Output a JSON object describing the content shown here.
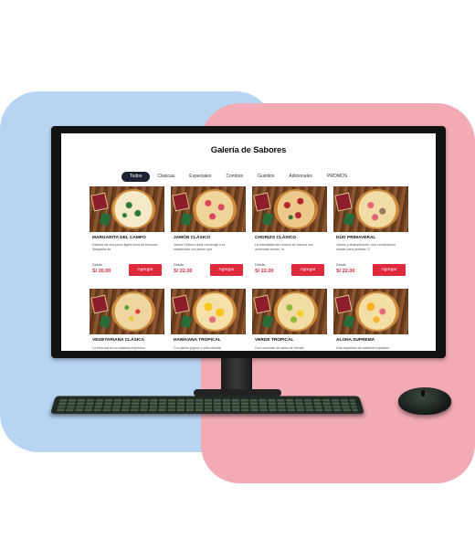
{
  "page": {
    "title": "Galería de Sabores"
  },
  "tabs": [
    {
      "label": "Todos",
      "active": true
    },
    {
      "label": "Clasicas",
      "active": false
    },
    {
      "label": "Especiales",
      "active": false
    },
    {
      "label": "Combos",
      "active": false
    },
    {
      "label": "Gustitos",
      "active": false
    },
    {
      "label": "Adicionales",
      "active": false
    },
    {
      "label": "PROMOS",
      "active": false
    }
  ],
  "products": [
    {
      "name": "MARGARITA DEL CAMPO",
      "desc": "Disfruta de una pizza ligera llena de frescura. Margarita de",
      "from_label": "Desde",
      "price": "S/ 20.00",
      "button": "Agregar",
      "topping": "margarita"
    },
    {
      "name": "JAMÓN CLÁSICO",
      "desc": "Jamón Clásico rinde homenaje a la simplicidad con jamón que",
      "from_label": "Desde",
      "price": "S/ 22.00",
      "button": "Agregar",
      "topping": "ham"
    },
    {
      "name": "CHORIZO CLÁSICO",
      "desc": "La intensidad del chorizo se fusiona con aceitunas verdes, la",
      "from_label": "Desde",
      "price": "S/ 22.00",
      "button": "Agregar",
      "topping": "chorizo"
    },
    {
      "name": "DÚO PRIMAVERAL",
      "desc": "Jamón y champiñones, una combinación simple para perfecta. E",
      "from_label": "Desde",
      "price": "S/ 22.00",
      "button": "Agregar",
      "topping": "duo"
    },
    {
      "name": "VEGETARIANA CLÁSICA",
      "desc": "La frescura en su máxima expresión",
      "topping": "veggie"
    },
    {
      "name": "HAWAIANA TROPICAL",
      "desc": "Con jamón jugoso y piña dorada",
      "topping": "hawaiian"
    },
    {
      "name": "VERDE TROPICAL",
      "desc": "Con una base de salsa de tomate",
      "topping": "green"
    },
    {
      "name": "ALOHA SUPREMA",
      "desc": "Una explosión de sabores tropicales",
      "topping": "aloha"
    }
  ],
  "colors": {
    "accent": "#e0293d",
    "price": "#d62938",
    "active_tab": "#1d2233",
    "bg_blue": "#b8d4f3",
    "bg_pink": "#f2aab5"
  }
}
